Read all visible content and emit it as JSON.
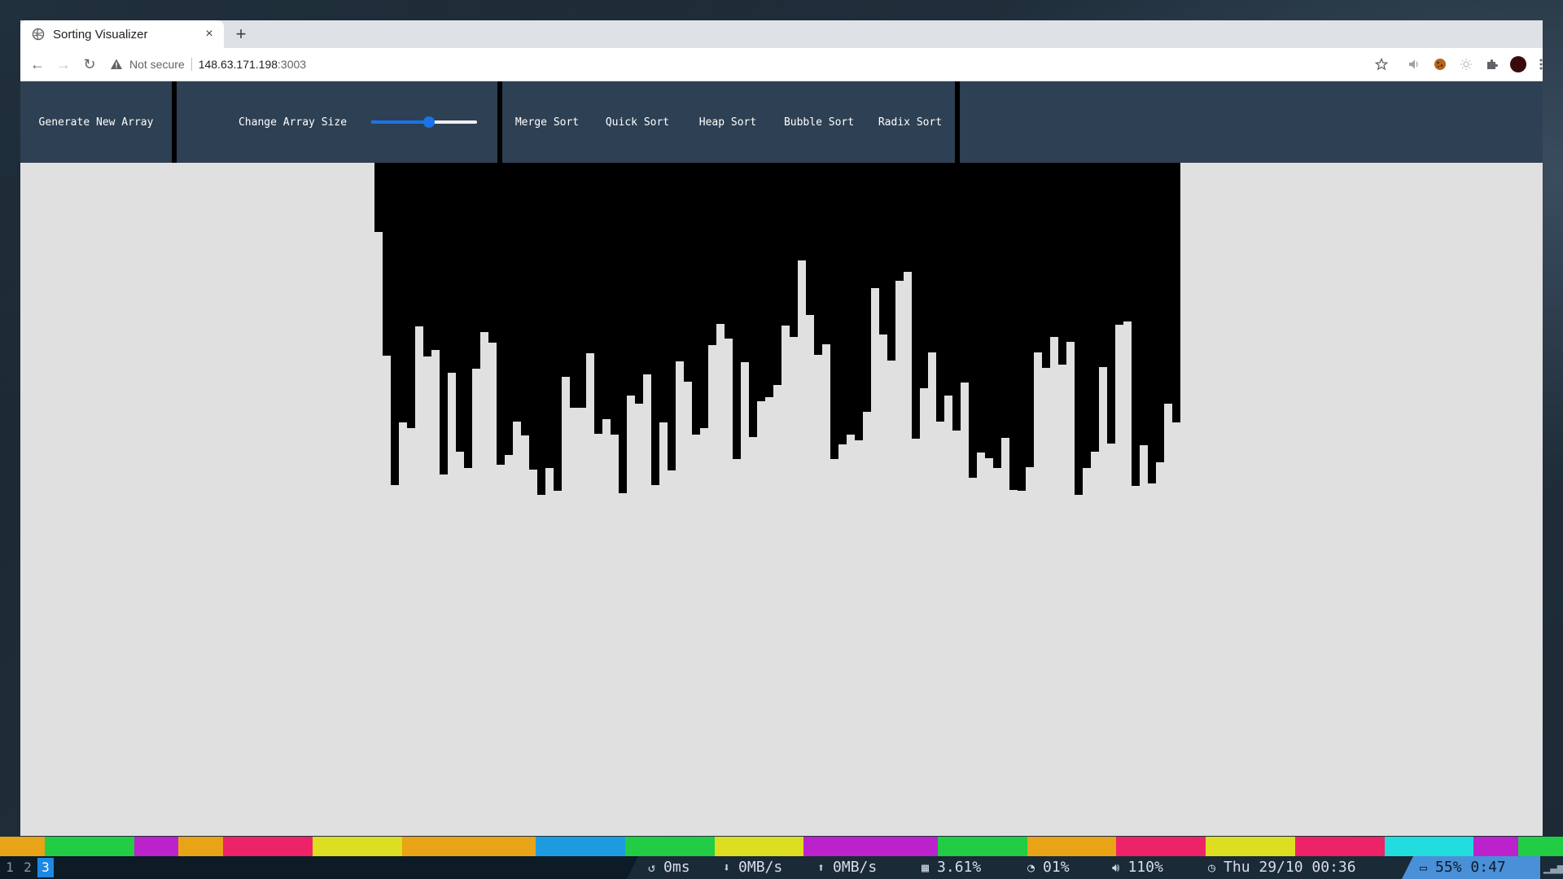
{
  "browser": {
    "tab_title": "Sorting Visualizer",
    "tab_close": "×",
    "new_tab": "+",
    "security_label": "Not secure",
    "url_host": "148.63.171.198",
    "url_port": ":3003"
  },
  "navbar": {
    "generate_label": "Generate New Array",
    "size_label": "Change Array Size",
    "slider_value": 0.55,
    "algorithms": [
      "Merge Sort",
      "Quick Sort",
      "Heap Sort",
      "Bubble Sort",
      "Radix Sort"
    ]
  },
  "array": {
    "bar_color": "#000000",
    "values": [
      85,
      237,
      396,
      319,
      326,
      201,
      238,
      230,
      383,
      258,
      355,
      375,
      253,
      208,
      221,
      371,
      359,
      318,
      335,
      377,
      408,
      375,
      403,
      263,
      301,
      301,
      234,
      333,
      315,
      334,
      406,
      286,
      296,
      260,
      396,
      319,
      378,
      244,
      269,
      334,
      326,
      224,
      198,
      216,
      364,
      245,
      337,
      293,
      288,
      273,
      200,
      214,
      120,
      187,
      236,
      223,
      364,
      346,
      334,
      341,
      306,
      154,
      211,
      243,
      145,
      134,
      339,
      277,
      233,
      318,
      286,
      329,
      270,
      387,
      356,
      363,
      375,
      338,
      402,
      403,
      374,
      233,
      252,
      214,
      248,
      220,
      408,
      375,
      355,
      251,
      345,
      199,
      195,
      397,
      347,
      394,
      368,
      296,
      319
    ]
  },
  "statusbar": {
    "workspaces": [
      "1",
      "2",
      "3"
    ],
    "active_workspace": "3",
    "ping": "0ms",
    "download": "0MB/s",
    "upload": "0MB/s",
    "cpu": "3.61%",
    "disk": "01%",
    "volume": "110%",
    "clock": "Thu 29/10 00:36",
    "battery": "55%",
    "battery_time": "0:47"
  },
  "colors": {
    "navbar_bg": "#2e4053",
    "page_bg": "#e0e0e0",
    "accent": "#1a73e8",
    "strip": [
      "#e8a317",
      "#22cc44",
      "#22cc44",
      "#bb22cc",
      "#e8a317",
      "#ee2266",
      "#ee2266",
      "#dddd22",
      "#dddd22",
      "#e8a317",
      "#e8a317",
      "#e8a317",
      "#1e9be0",
      "#1e9be0",
      "#22cc44",
      "#22cc44",
      "#dddd22",
      "#dddd22",
      "#bb22cc",
      "#bb22cc",
      "#bb22cc",
      "#22cc44",
      "#22cc44",
      "#e8a317",
      "#e8a317",
      "#ee2266",
      "#ee2266",
      "#dddd22",
      "#dddd22",
      "#ee2266",
      "#ee2266",
      "#22dddd",
      "#22dddd",
      "#bb22cc",
      "#22cc44"
    ]
  }
}
